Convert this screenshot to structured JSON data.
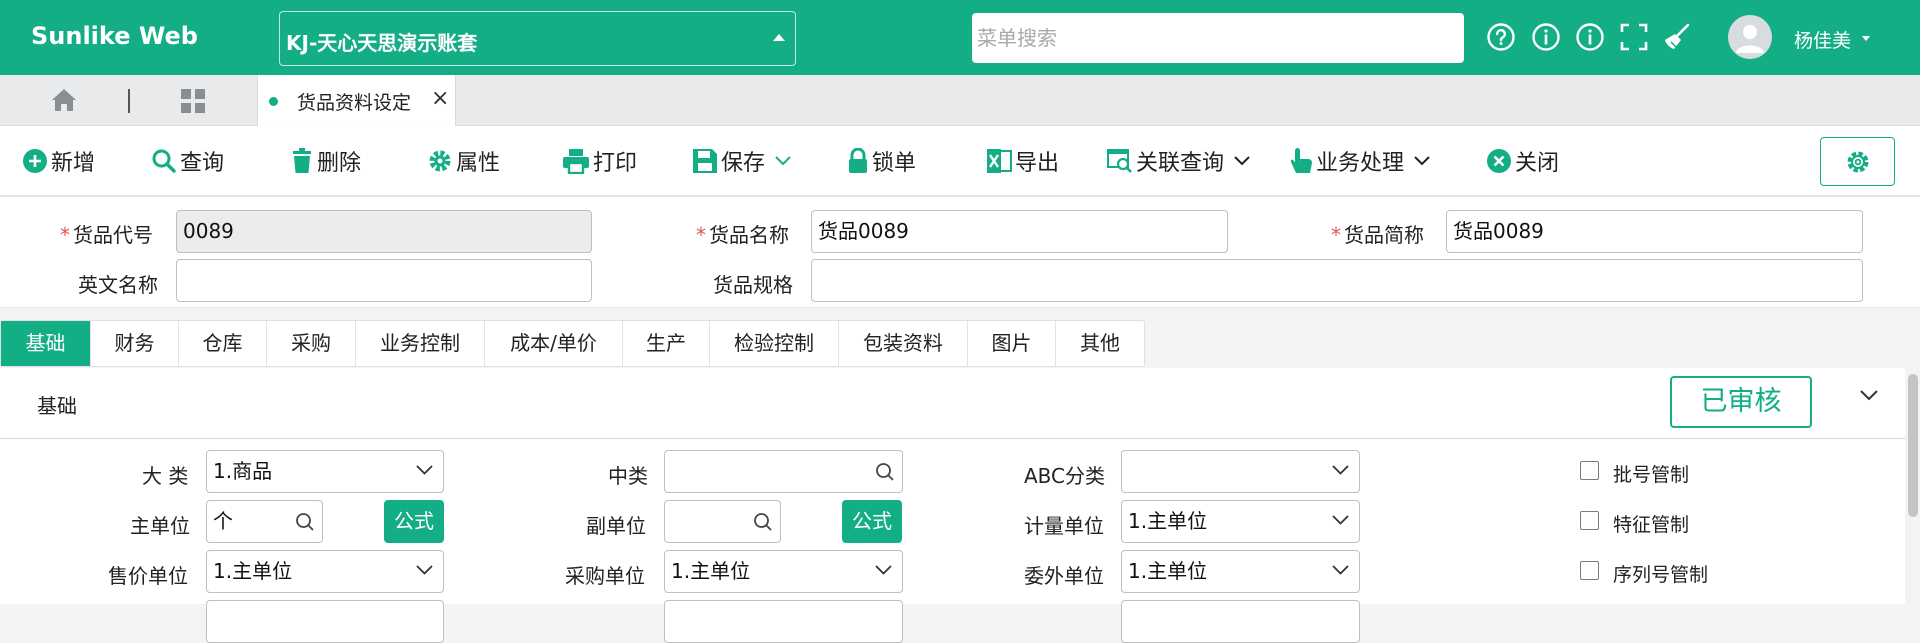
{
  "app": {
    "brand": "Sunlike Web",
    "account": "KJ-天心天思演示账套"
  },
  "search": {
    "placeholder": "菜单搜索"
  },
  "user": {
    "name": "杨佳美"
  },
  "page_tab": {
    "label": "货品资料设定"
  },
  "toolbar": {
    "add": "新增",
    "query": "查询",
    "delete": "删除",
    "properties": "属性",
    "print": "打印",
    "save": "保存",
    "lock": "锁单",
    "export": "导出",
    "related_query": "关联查询",
    "business": "业务处理",
    "close": "关闭"
  },
  "form": {
    "code_label": "货品代号",
    "code_value": "0089",
    "name_label": "货品名称",
    "name_value": "货品0089",
    "short_label": "货品简称",
    "short_value": "货品0089",
    "en_label": "英文名称",
    "en_value": "",
    "spec_label": "货品规格",
    "spec_value": ""
  },
  "detail_tabs": [
    "基础",
    "财务",
    "仓库",
    "采购",
    "业务控制",
    "成本/单价",
    "生产",
    "检验控制",
    "包装资料",
    "图片",
    "其他"
  ],
  "panel": {
    "title": "基础",
    "status": "已审核",
    "major_label": "大 类",
    "major_value": "1.商品",
    "mid_label": "中类",
    "mid_value": "",
    "abc_label": "ABC分类",
    "abc_value": "",
    "batch_label": "批号管制",
    "main_unit_label": "主单位",
    "main_unit_value": "个",
    "formula": "公式",
    "sub_unit_label": "副单位",
    "sub_unit_value": "",
    "measure_label": "计量单位",
    "measure_value": "1.主单位",
    "feature_label": "特征管制",
    "sell_unit_label": "售价单位",
    "sell_unit_value": "1.主单位",
    "buy_unit_label": "采购单位",
    "buy_unit_value": "1.主单位",
    "outsource_label": "委外单位",
    "outsource_value": "1.主单位",
    "serial_label": "序列号管制"
  },
  "colors": {
    "accent": "#13ae86",
    "required": "#e0564f"
  }
}
